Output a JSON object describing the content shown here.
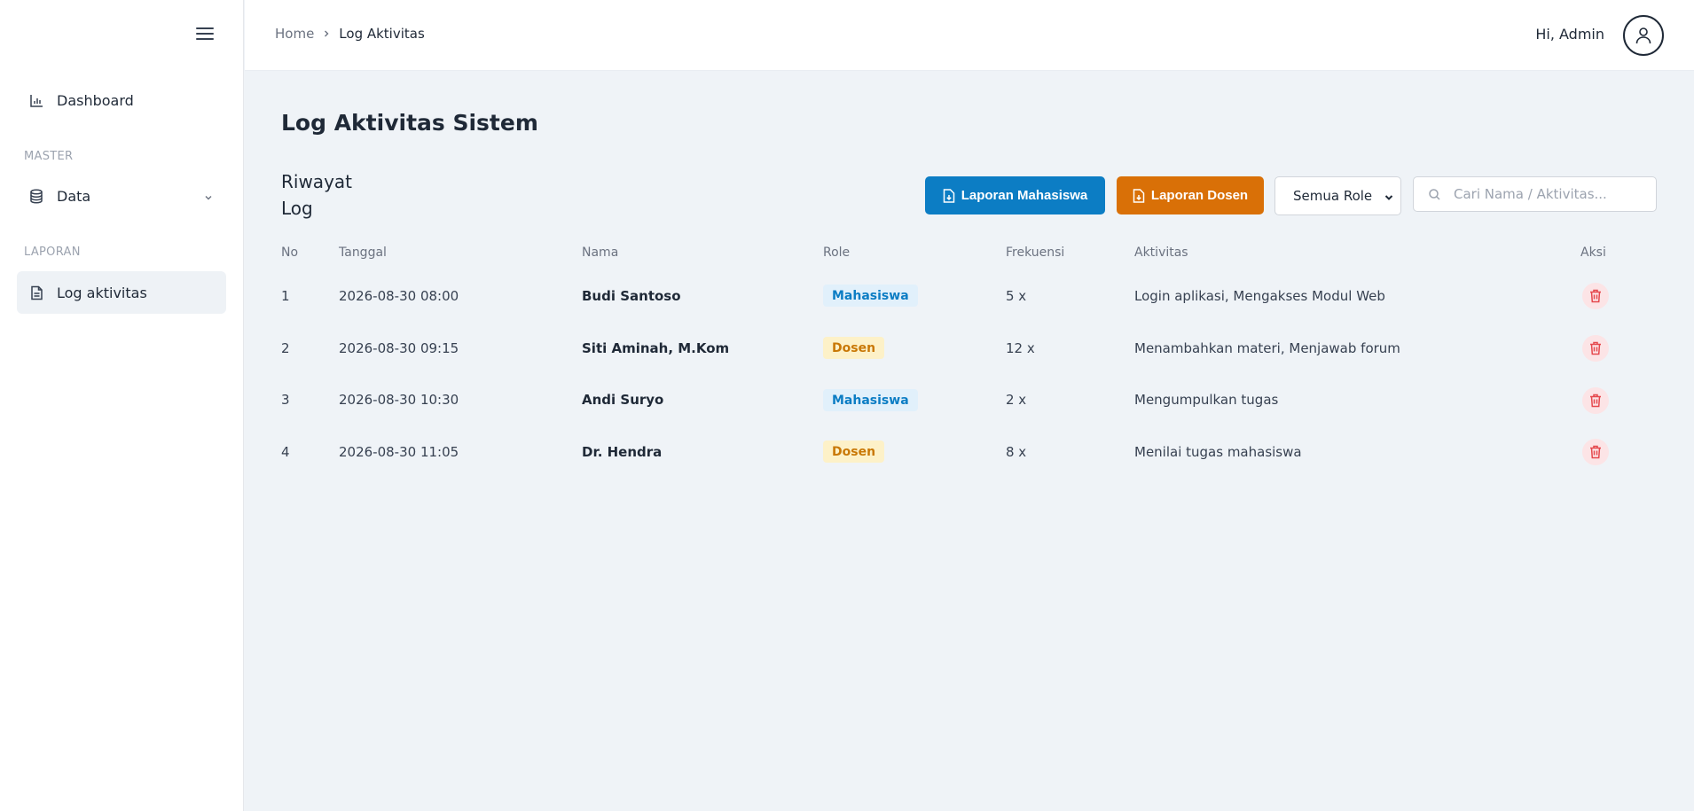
{
  "sidebar": {
    "items": [
      {
        "label": "Dashboard",
        "icon": "bar-chart-icon"
      },
      {
        "label": "Data",
        "icon": "database-icon"
      },
      {
        "label": "Log aktivitas",
        "icon": "file-text-icon"
      }
    ],
    "sections": [
      "MASTER",
      "LAPORAN"
    ]
  },
  "header": {
    "breadcrumb": {
      "home": "Home",
      "current": "Log Aktivitas"
    },
    "greeting": "Hi, Admin"
  },
  "main": {
    "title": "Log Aktivitas Sistem",
    "subtitle_line1": "Riwayat",
    "subtitle_line2": "Log",
    "buttons": {
      "laporan_mahasiswa": "Laporan Mahasiswa",
      "laporan_dosen": "Laporan Dosen"
    },
    "role_filter": {
      "selected": "Semua Role"
    },
    "search": {
      "placeholder": "Cari Nama / Aktivitas..."
    }
  },
  "table": {
    "headers": [
      "No",
      "Tanggal",
      "Nama",
      "Role",
      "Frekuensi",
      "Aktivitas",
      "Aksi"
    ],
    "rows": [
      {
        "no": "1",
        "tanggal": "2026-08-30 08:00",
        "nama": "Budi Santoso",
        "role": "Mahasiswa",
        "frekuensi": "5 x",
        "aktivitas": "Login aplikasi, Mengakses Modul Web"
      },
      {
        "no": "2",
        "tanggal": "2026-08-30 09:15",
        "nama": "Siti Aminah, M.Kom",
        "role": "Dosen",
        "frekuensi": "12 x",
        "aktivitas": "Menambahkan materi, Menjawab forum"
      },
      {
        "no": "3",
        "tanggal": "2026-08-30 10:30",
        "nama": "Andi Suryo",
        "role": "Mahasiswa",
        "frekuensi": "2 x",
        "aktivitas": "Mengumpulkan tugas"
      },
      {
        "no": "4",
        "tanggal": "2026-08-30 11:05",
        "nama": "Dr. Hendra",
        "role": "Dosen",
        "frekuensi": "8 x",
        "aktivitas": "Menilai tugas mahasiswa"
      }
    ]
  },
  "colors": {
    "primary_blue": "#0c7dc4",
    "primary_orange": "#d97007",
    "delete_red": "#e5484d",
    "page_bg": "#eff3f7"
  }
}
